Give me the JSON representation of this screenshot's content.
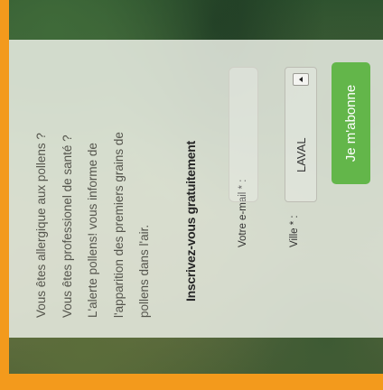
{
  "intro": {
    "lines": [
      "Vous êtes allergique aux pollens ?",
      "Vous êtes professionel de santé ?",
      "L'alerte pollens! vous informe de",
      "l'apparition des premiers grains de",
      "pollens dans l'air."
    ]
  },
  "form": {
    "heading": "Inscrivez-vous gratuitement",
    "email_label": "Votre e-mail * :",
    "email_value": "",
    "ville_label": "Ville * :",
    "ville_value": "LAVAL",
    "subscribe_label": "Je m'abonne"
  },
  "colors": {
    "frame": "#f39a1c",
    "button": "#63b64a",
    "overlay": "#eaeee4"
  }
}
